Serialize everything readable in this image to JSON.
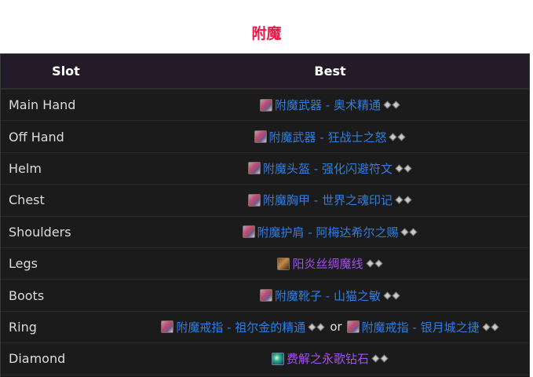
{
  "title": "附魔",
  "header": {
    "slot": "Slot",
    "best": "Best"
  },
  "rows": [
    {
      "slot": "Main Hand",
      "items": [
        {
          "name": "附魔武器 - 奥术精通",
          "icon": "enchant-scroll-icon",
          "color": "blue"
        }
      ]
    },
    {
      "slot": "Off Hand",
      "items": [
        {
          "name": "附魔武器 - 狂战士之怒",
          "icon": "enchant-scroll-icon",
          "color": "blue"
        }
      ]
    },
    {
      "slot": "Helm",
      "items": [
        {
          "name": "附魔头盔 - 强化闪避符文",
          "icon": "enchant-scroll-icon",
          "color": "blue"
        }
      ]
    },
    {
      "slot": "Chest",
      "items": [
        {
          "name": "附魔胸甲 - 世界之魂印记",
          "icon": "enchant-scroll-icon",
          "color": "blue"
        }
      ]
    },
    {
      "slot": "Shoulders",
      "items": [
        {
          "name": "附魔护肩 - 阿梅达希尔之赐",
          "icon": "enchant-scroll-icon",
          "color": "blue"
        }
      ]
    },
    {
      "slot": "Legs",
      "items": [
        {
          "name": "阳炎丝绸魔线",
          "icon": "spellthread-icon",
          "color": "purple"
        }
      ]
    },
    {
      "slot": "Boots",
      "items": [
        {
          "name": "附魔靴子 - 山猫之敏",
          "icon": "enchant-scroll-icon",
          "color": "blue"
        }
      ]
    },
    {
      "slot": "Ring",
      "items": [
        {
          "name": "附魔戒指 - 祖尔金的精通",
          "icon": "enchant-scroll-icon",
          "color": "blue"
        },
        {
          "name": "附魔戒指 - 银月城之捷",
          "icon": "enchant-scroll-icon",
          "color": "blue"
        }
      ],
      "separator": "or"
    },
    {
      "slot": "Diamond",
      "items": [
        {
          "name": "费解之永歌钻石",
          "icon": "gem-icon",
          "color": "purple"
        }
      ]
    }
  ],
  "colors": {
    "title": "#e8194a",
    "rare_blue": "#2f7ddf",
    "epic_purple": "#a24ff0",
    "table_bg": "#1c1b1c",
    "header_bg": "#231c28"
  }
}
